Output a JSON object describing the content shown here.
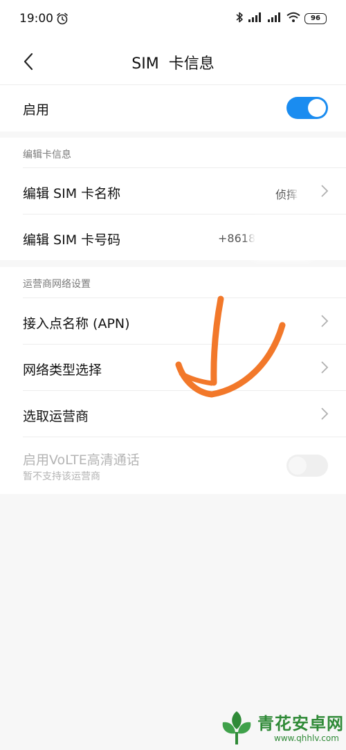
{
  "status_bar": {
    "time": "19:00",
    "battery": "96",
    "icons": [
      "alarm-icon",
      "bluetooth-icon",
      "signal-icon",
      "signal-icon",
      "wifi-icon",
      "battery-icon"
    ]
  },
  "header": {
    "title": "SIM  卡信息"
  },
  "enable_row": {
    "label": "启用",
    "enabled": true
  },
  "edit_section": {
    "header": "编辑卡信息",
    "items": [
      {
        "label": "编辑 SIM 卡名称",
        "value": "侦挥"
      },
      {
        "label": "编辑 SIM 卡号码",
        "value": "+8618"
      }
    ]
  },
  "network_section": {
    "header": "运营商网络设置",
    "items": [
      {
        "label": "接入点名称 (APN)"
      },
      {
        "label": "网络类型选择"
      },
      {
        "label": "选取运营商"
      }
    ],
    "volte": {
      "label": "启用VoLTE高清通话",
      "sublabel": "暂不支持该运营商",
      "enabled": false
    }
  },
  "watermark": {
    "text": "青花安卓网",
    "url": "www.qhhlv.com"
  },
  "colors": {
    "accent": "#1a8cf0",
    "annotation": "#f2782a",
    "background": "#f7f7f7"
  }
}
